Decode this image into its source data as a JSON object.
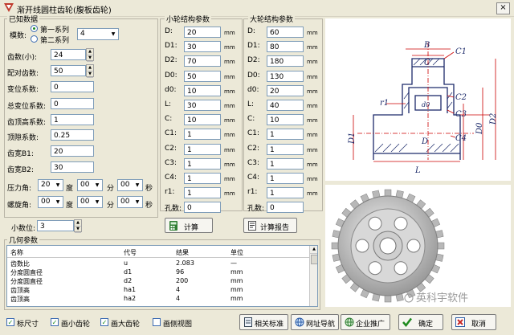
{
  "window": {
    "title": "渐开线圆柱齿轮(腹板齿轮)",
    "close": "×"
  },
  "known": {
    "group_title": "已知数据",
    "module_label": "模数:",
    "series1": "第一系列",
    "series2": "第二系列",
    "module_value": "4",
    "teeth_small_label": "齿数(小):",
    "teeth_small_value": "24",
    "teeth_mate_label": "配对齿数:",
    "teeth_mate_value": "50",
    "shift_label": "变位系数:",
    "shift_value": "0",
    "total_shift_label": "总变位系数:",
    "total_shift_value": "0",
    "addendum_label": "齿顶高系数:",
    "addendum_value": "1",
    "clearance_label": "顶隙系数:",
    "clearance_value": "0.25",
    "width_b1_label": "齿宽B1:",
    "width_b1_value": "20",
    "width_b2_label": "齿宽B2:",
    "width_b2_value": "30",
    "pressure_label": "压力角:",
    "pressure_deg": "20",
    "pressure_min": "00",
    "pressure_sec": "00",
    "helix_label": "螺旋角:",
    "helix_deg": "00",
    "helix_min": "00",
    "helix_sec": "00",
    "deg": "度",
    "min": "分",
    "sec": "秒",
    "decimals_label": "小数位:",
    "decimals_value": "3"
  },
  "small_wheel": {
    "title": "小轮结构参数",
    "rows": [
      {
        "label": "D:",
        "value": "20",
        "unit": "mm"
      },
      {
        "label": "D1:",
        "value": "30",
        "unit": "mm"
      },
      {
        "label": "D2:",
        "value": "70",
        "unit": "mm"
      },
      {
        "label": "D0:",
        "value": "50",
        "unit": "mm"
      },
      {
        "label": "d0:",
        "value": "10",
        "unit": "mm"
      },
      {
        "label": "L:",
        "value": "30",
        "unit": "mm"
      },
      {
        "label": "C:",
        "value": "10",
        "unit": "mm"
      },
      {
        "label": "C1:",
        "value": "1",
        "unit": "mm"
      },
      {
        "label": "C2:",
        "value": "1",
        "unit": "mm"
      },
      {
        "label": "C3:",
        "value": "1",
        "unit": "mm"
      },
      {
        "label": "C4:",
        "value": "1",
        "unit": "mm"
      },
      {
        "label": "r1:",
        "value": "1",
        "unit": "mm"
      },
      {
        "label": "孔数:",
        "value": "0",
        "unit": ""
      }
    ]
  },
  "large_wheel": {
    "title": "大轮结构参数",
    "rows": [
      {
        "label": "D:",
        "value": "60",
        "unit": "mm"
      },
      {
        "label": "D1:",
        "value": "80",
        "unit": "mm"
      },
      {
        "label": "D2:",
        "value": "180",
        "unit": "mm"
      },
      {
        "label": "D0:",
        "value": "130",
        "unit": "mm"
      },
      {
        "label": "d0:",
        "value": "20",
        "unit": "mm"
      },
      {
        "label": "L:",
        "value": "40",
        "unit": "mm"
      },
      {
        "label": "C:",
        "value": "10",
        "unit": "mm"
      },
      {
        "label": "C1:",
        "value": "1",
        "unit": "mm"
      },
      {
        "label": "C2:",
        "value": "1",
        "unit": "mm"
      },
      {
        "label": "C3:",
        "value": "1",
        "unit": "mm"
      },
      {
        "label": "C4:",
        "value": "1",
        "unit": "mm"
      },
      {
        "label": "r1:",
        "value": "1",
        "unit": "mm"
      },
      {
        "label": "孔数:",
        "value": "0",
        "unit": ""
      }
    ]
  },
  "buttons": {
    "calc": "计算",
    "report": "计算报告",
    "standards": "相关标准",
    "nav": "网址导航",
    "promo": "企业推广",
    "ok": "确定",
    "cancel": "取消"
  },
  "geometry": {
    "group_title": "几何参数",
    "columns": [
      "名称",
      "代号",
      "结果",
      "单位"
    ],
    "rows": [
      [
        "齿数比",
        "u",
        "2.083",
        "—"
      ],
      [
        "分度圆直径",
        "d1",
        "96",
        "mm"
      ],
      [
        "分度圆直径",
        "d2",
        "200",
        "mm"
      ],
      [
        "齿顶高",
        "ha1",
        "4",
        "mm"
      ],
      [
        "齿顶高",
        "ha2",
        "4",
        "mm"
      ]
    ]
  },
  "checks": {
    "dims": "标尺寸",
    "small_gear": "画小齿轮",
    "large_gear": "画大齿轮",
    "side_view": "画侧视图"
  },
  "diagram_labels": [
    "B",
    "C",
    "C1",
    "C2",
    "C3",
    "C4",
    "r1",
    "d0",
    "D",
    "D1",
    "D0",
    "D2",
    "L"
  ],
  "watermark": "英科宇软件",
  "colors": {
    "accent": "#cc0000",
    "blueprint": "#1c2a6a"
  }
}
